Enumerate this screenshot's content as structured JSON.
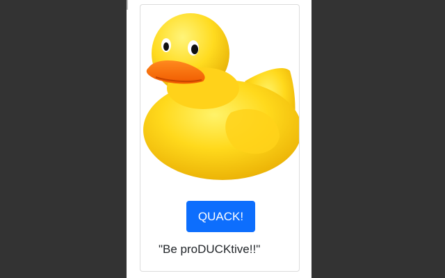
{
  "popup": {
    "image_alt": "rubber duck",
    "button_label": "QUACK!",
    "quote": "\"Be proDUCKtive!!\""
  },
  "colors": {
    "backdrop": "#333333",
    "button_bg": "#0d6efd",
    "duck_yellow": "#ffd21a",
    "beak_orange": "#ff6a00"
  }
}
